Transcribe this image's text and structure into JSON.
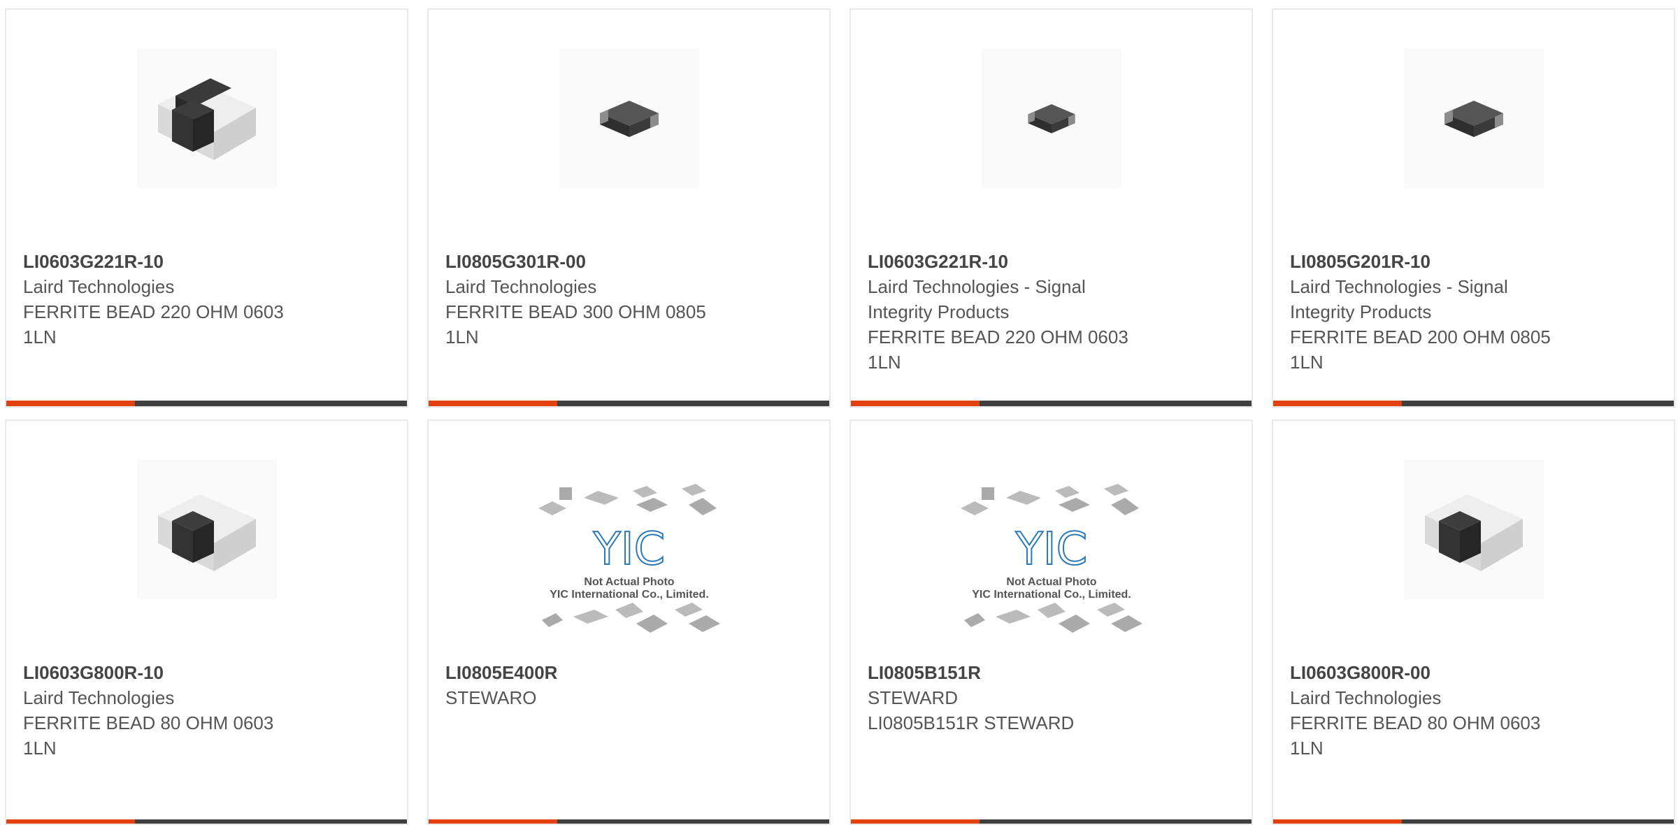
{
  "products": [
    {
      "part": "LI0603G221R-10",
      "maker": "Laird Technologies",
      "desc": [
        "FERRITE BEAD 220 OHM 0603",
        "1LN"
      ],
      "image": "large-chip-icon"
    },
    {
      "part": "LI0805G301R-00",
      "maker": "Laird Technologies",
      "desc": [
        "FERRITE BEAD 300 OHM 0805",
        "1LN"
      ],
      "image": "small-chip-icon"
    },
    {
      "part": "LI0603G221R-10",
      "maker": "Laird Technologies - Signal Integrity Products",
      "desc": [
        "FERRITE BEAD 220 OHM 0603",
        "1LN"
      ],
      "image": "small-chip-icon"
    },
    {
      "part": "LI0805G201R-10",
      "maker": "Laird Technologies - Signal Integrity Products",
      "desc": [
        "FERRITE BEAD 200 OHM 0805",
        "1LN"
      ],
      "image": "small-chip-icon"
    },
    {
      "part": "LI0603G800R-10",
      "maker": "Laird Technologies",
      "desc": [
        "FERRITE BEAD 80 OHM 0603",
        "1LN"
      ],
      "image": "large-chip-icon"
    },
    {
      "part": "LI0805E400R",
      "maker": "STEWARO",
      "desc": [],
      "image": "yic-placeholder"
    },
    {
      "part": "LI0805B151R",
      "maker": "STEWARD",
      "desc": [
        "LI0805B151R STEWARD"
      ],
      "image": "yic-placeholder"
    },
    {
      "part": "LI0603G800R-00",
      "maker": "Laird Technologies",
      "desc": [
        "FERRITE BEAD 80 OHM 0603",
        "1LN"
      ],
      "image": "large-chip-icon"
    }
  ],
  "placeholder": {
    "logo": "YIC",
    "line1": "Not Actual Photo",
    "line2": "YIC International Co., Limited."
  },
  "colors": {
    "accent": "#e3410f",
    "bar": "#3f3f3f",
    "text": "#555555"
  }
}
